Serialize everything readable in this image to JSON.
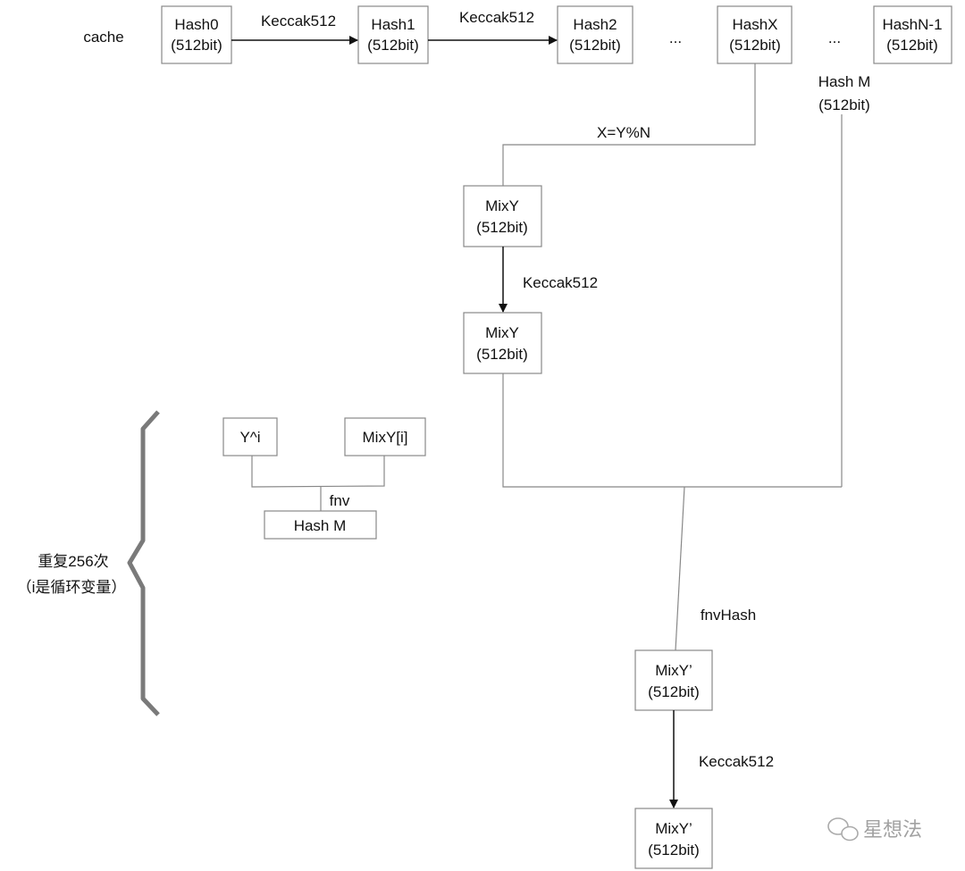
{
  "cache_label": "cache",
  "top_row": [
    {
      "name": "Hash0",
      "size": "(512bit)"
    },
    {
      "name": "Hash1",
      "size": "(512bit)"
    },
    {
      "name": "Hash2",
      "size": "(512bit)"
    },
    {
      "name": "HashX",
      "size": "(512bit)"
    },
    {
      "name": "HashN-1",
      "size": "(512bit)"
    }
  ],
  "ellipsis": "...",
  "edge_keccak": "Keccak512",
  "hash_m_label": {
    "name": "Hash M",
    "size": "(512bit)"
  },
  "index_label": "X=Y%N",
  "mix": [
    {
      "name": "MixY",
      "size": "(512bit)"
    },
    {
      "name": "MixY",
      "size": "(512bit)"
    },
    {
      "name": "MixY’",
      "size": "(512bit)"
    },
    {
      "name": "MixY’",
      "size": "(512bit)"
    }
  ],
  "fnvhash_label": "fnvHash",
  "loop": {
    "a": "Y^i",
    "b": "MixY[i]",
    "op": "fnv",
    "out": "Hash M",
    "repeat_line1": "重复256次",
    "repeat_line2": "（i是循环变量）"
  },
  "watermark": "星想法"
}
